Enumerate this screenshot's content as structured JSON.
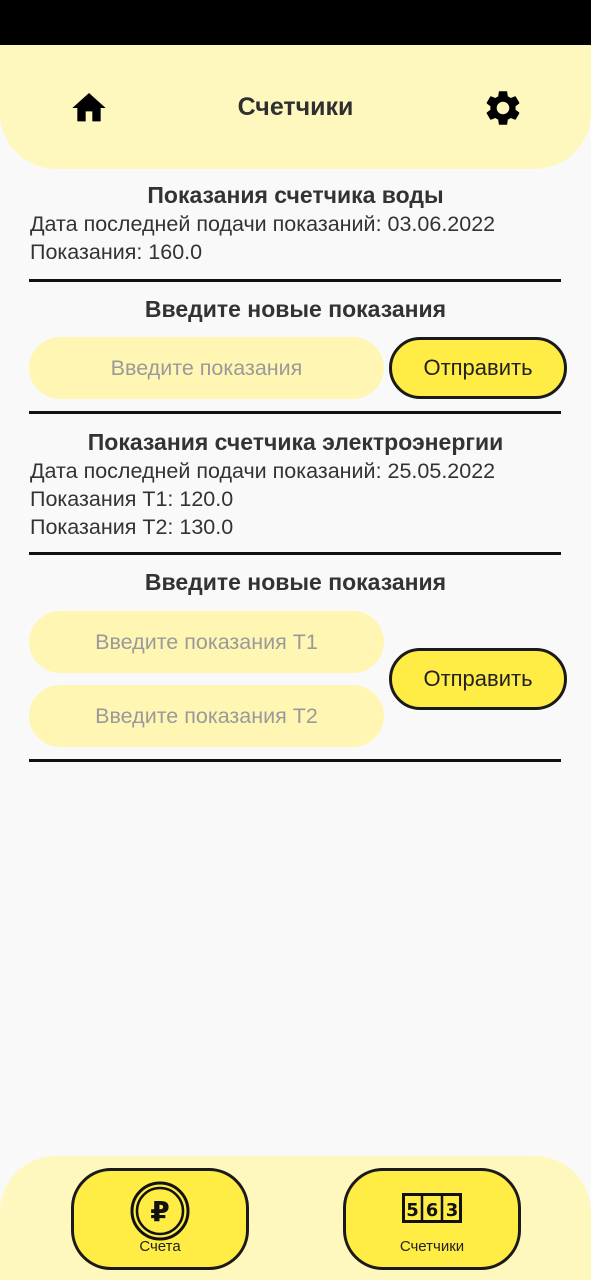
{
  "header": {
    "title": "Счетчики",
    "left_icon": "home-icon",
    "right_icon": "gear-icon"
  },
  "water": {
    "title": "Показания счетчика воды",
    "last_date_line": "Дата последней подачи показаний: 03.06.2022",
    "reading_line": "Показания: 160.0",
    "new_title": "Введите новые показания",
    "input_placeholder": "Введите показания",
    "submit_label": "Отправить"
  },
  "electricity": {
    "title": "Показания счетчика электроэнергии",
    "last_date_line": "Дата последней подачи показаний: 25.05.2022",
    "t1_line": "Показания T1: 120.0",
    "t2_line": "Показания T2: 130.0",
    "new_title": "Введите новые показания",
    "t1_placeholder": "Введите показания T1",
    "t2_placeholder": "Введите показания T2",
    "submit_label": "Отправить"
  },
  "bottom_nav": {
    "items": [
      {
        "label": "Счета",
        "icon": "ruble-coin-icon"
      },
      {
        "label": "Счетчики",
        "icon": "meter-counter-icon"
      }
    ]
  },
  "colors": {
    "accent": "#ffec45",
    "panel": "#fff8be",
    "input_bg": "#fff6b4",
    "background": "#f9f9f9",
    "status_bar": "#000000"
  }
}
